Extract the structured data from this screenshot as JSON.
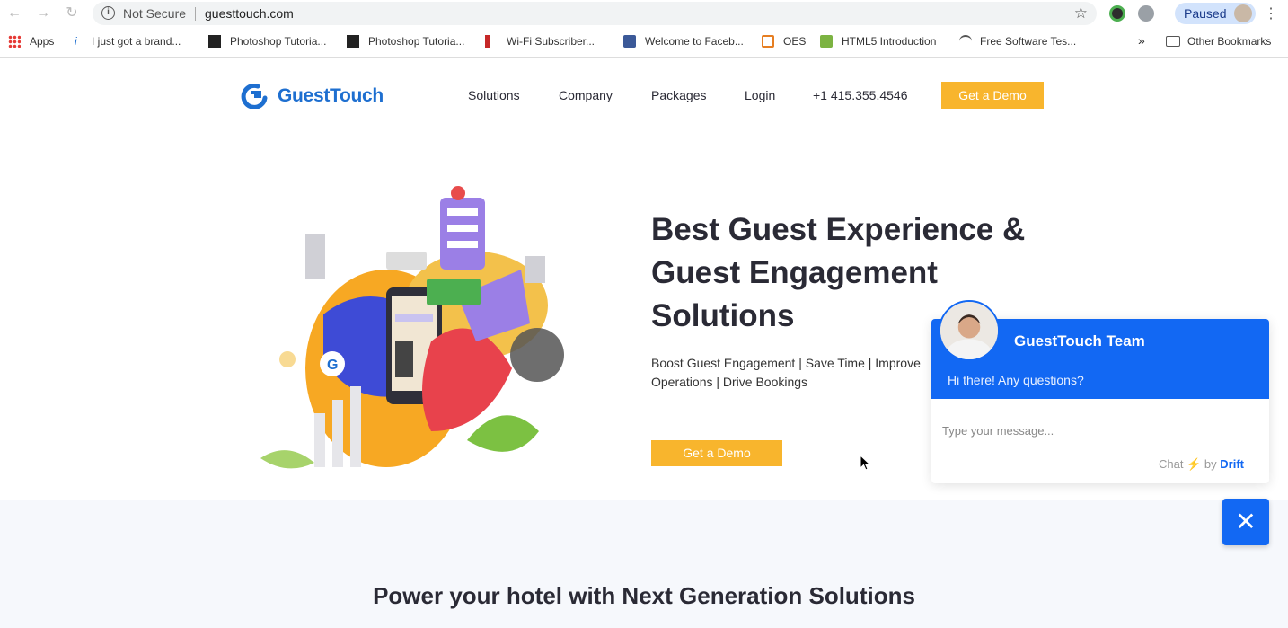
{
  "browser": {
    "security_label": "Not Secure",
    "url": "guesttouch.com",
    "profile_label": "Paused"
  },
  "bookmarks": {
    "items": [
      "Apps",
      "I just got a brand...",
      "Photoshop Tutoria...",
      "Photoshop Tutoria...",
      "Wi-Fi Subscriber...",
      "Welcome to Faceb...",
      "OES",
      "HTML5 Introduction",
      "Free Software Tes..."
    ],
    "overflow_label": "»",
    "other_label": "Other Bookmarks"
  },
  "header": {
    "logo_text": "GuestTouch",
    "nav": [
      "Solutions",
      "Company",
      "Packages",
      "Login",
      "+1 415.355.4546"
    ],
    "cta_label": "Get a Demo"
  },
  "hero": {
    "title": "Best Guest Experience & Guest Engagement Solutions",
    "subtitle": "Boost Guest Engagement | Save Time | Improve Operations | Drive Bookings",
    "cta_label": "Get a Demo"
  },
  "lower": {
    "title": "Power your hotel with Next Generation Solutions"
  },
  "chat": {
    "team_name": "GuestTouch Team",
    "greeting": "Hi there! Any questions?",
    "input_placeholder": "Type your message...",
    "brand_prefix": "Chat",
    "brand_by": "by",
    "brand_name": "Drift",
    "close_symbol": "✕"
  },
  "colors": {
    "brand_blue": "#1e6fd0",
    "chat_blue": "#1268f3",
    "accent_orange": "#f8b52d"
  },
  "icons": [
    "back-icon",
    "forward-icon",
    "reload-icon",
    "info-icon",
    "star-icon",
    "close-icon",
    "bolt-icon"
  ]
}
